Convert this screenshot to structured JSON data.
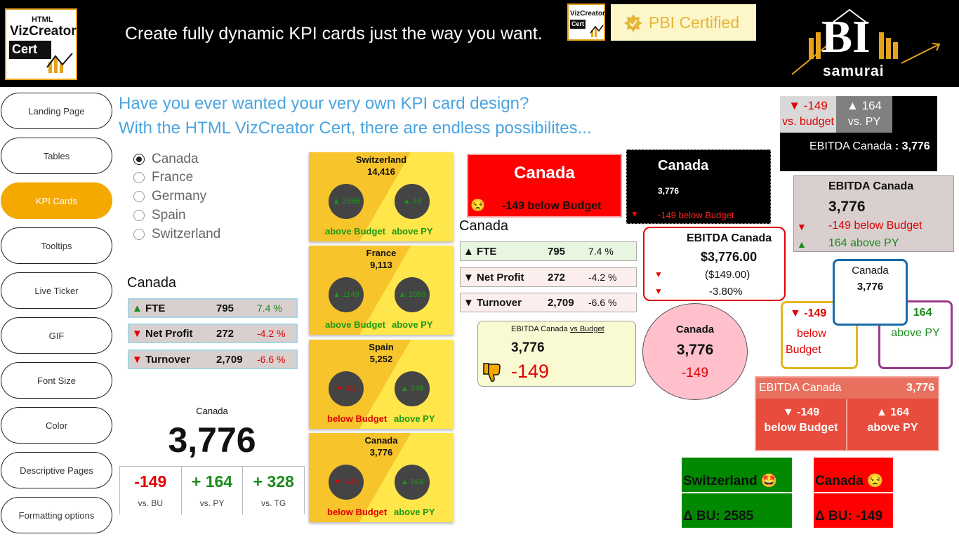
{
  "header": {
    "logo_line1": "HTML",
    "logo_line2": "VizCreator",
    "logo_line3": "Cert",
    "title": "Create fully dynamic KPI cards just the way you want.",
    "cert_badge": "PBI Certified",
    "brand_big": "BI",
    "brand_small": "samurai"
  },
  "nav": [
    {
      "label": "Landing Page"
    },
    {
      "label": "Tables"
    },
    {
      "label": "KPI Cards",
      "active": true
    },
    {
      "label": "Tooltips"
    },
    {
      "label": "Live Ticker"
    },
    {
      "label": "GIF"
    },
    {
      "label": "Font Size"
    },
    {
      "label": "Color"
    },
    {
      "label": "Descriptive Pages"
    },
    {
      "label": "Formatting options"
    }
  ],
  "intro": {
    "line1": "Have you ever wanted your very own KPI card design?",
    "line2": "With the HTML VizCreator Cert, there are endless possibilites..."
  },
  "countries": [
    "Canada",
    "France",
    "Germany",
    "Spain",
    "Switzerland"
  ],
  "selected_country": "Canada",
  "table_left": {
    "title": "Canada",
    "rows": [
      {
        "arrow": "▲",
        "name": "FTE",
        "value": "795",
        "pct": "7.4 %"
      },
      {
        "arrow": "▼",
        "name": "Net Profit",
        "value": "272",
        "pct": "-4.2 %"
      },
      {
        "arrow": "▼",
        "name": "Turnover",
        "value": "2,709",
        "pct": "-6.6 %"
      }
    ]
  },
  "table_mid": {
    "title": "Canada",
    "rows": [
      {
        "arrow": "▲",
        "name": "FTE",
        "value": "795",
        "pct": "7.4 %"
      },
      {
        "arrow": "▼",
        "name": "Net Profit",
        "value": "272",
        "pct": "-4.2 %"
      },
      {
        "arrow": "▼",
        "name": "Turnover",
        "value": "2,709",
        "pct": "-6.6 %"
      }
    ]
  },
  "big_card": {
    "country": "Canada",
    "value": "3,776",
    "cells": [
      {
        "value": "-149",
        "label": "vs. BU"
      },
      {
        "value": "+ 164",
        "label": "vs. PY"
      },
      {
        "value": "+ 328",
        "label": "vs. TG"
      }
    ]
  },
  "yellow_cards": [
    {
      "name": "Switzerland",
      "value": "14,416",
      "bu": "▲ 2585",
      "py": "▲ 74",
      "bu_label": "above Budget",
      "py_label": "above PY",
      "bu_up": true
    },
    {
      "name": "France",
      "value": "9,113",
      "bu": "▲ 1149",
      "py": "▲ 1063",
      "bu_label": "above Budget",
      "py_label": "above PY",
      "bu_up": true
    },
    {
      "name": "Spain",
      "value": "5,252",
      "bu": "▼ -82",
      "py": "▲ 749",
      "bu_label": "below Budget",
      "py_label": "above PY",
      "bu_up": false
    },
    {
      "name": "Canada",
      "value": "3,776",
      "bu": "▼ -149",
      "py": "▲ 164",
      "bu_label": "below Budget",
      "py_label": "above PY",
      "bu_up": false
    }
  ],
  "red_card": {
    "title": "Canada",
    "emoji": "😒",
    "text": "-149 below Budget"
  },
  "black_card": {
    "title": "Canada",
    "value": "3,776",
    "arrow": "▼",
    "text": "-149 below Budget"
  },
  "outlined_card": {
    "title": "EBITDA Canada",
    "value": "$3,776.00",
    "line1": "($149.00)",
    "line2": "-3.80%",
    "arrow": "▼"
  },
  "thumb_card": {
    "title": "EBITDA Canada",
    "title_link": "vs Budget",
    "value": "3,776",
    "delta": "-149"
  },
  "pink_circle": {
    "title": "Canada",
    "value": "3,776",
    "delta": "-149"
  },
  "top_right": {
    "bu_delta": "▼ -149",
    "bu_label": "vs. budget",
    "py_delta": "▲ 164",
    "py_label": "vs. PY",
    "footer": "EBITDA Canada",
    "footer_value": "3,776"
  },
  "gray_card": {
    "title": "EBITDA Canada",
    "value": "3,776",
    "line1": "-149 below Budget",
    "line2": "164 above PY"
  },
  "three_boxes": {
    "center_title": "Canada",
    "center_value": "3,776",
    "left_delta": "▼ -149",
    "left_label1": "below",
    "left_label2": "Budget",
    "right_delta": "▲ 164",
    "right_label": "above PY"
  },
  "ebitda_red": {
    "title": "EBITDA Canada",
    "value": "3,776",
    "left_delta": "▼ -149",
    "left_label": "below Budget",
    "right_delta": "▲ 164",
    "right_label": "above PY"
  },
  "flags": [
    {
      "name": "Switzerland",
      "emoji": "🤩",
      "delta": "Δ BU: 2585",
      "color": "#008800"
    },
    {
      "name": "Canada",
      "emoji": "😒",
      "delta": "Δ BU: -149",
      "color": "#ff0000"
    }
  ],
  "colors": {
    "accent": "#f5a800",
    "link_blue": "#4aa4e0",
    "red": "#e00000",
    "green": "#1a8a1a"
  }
}
